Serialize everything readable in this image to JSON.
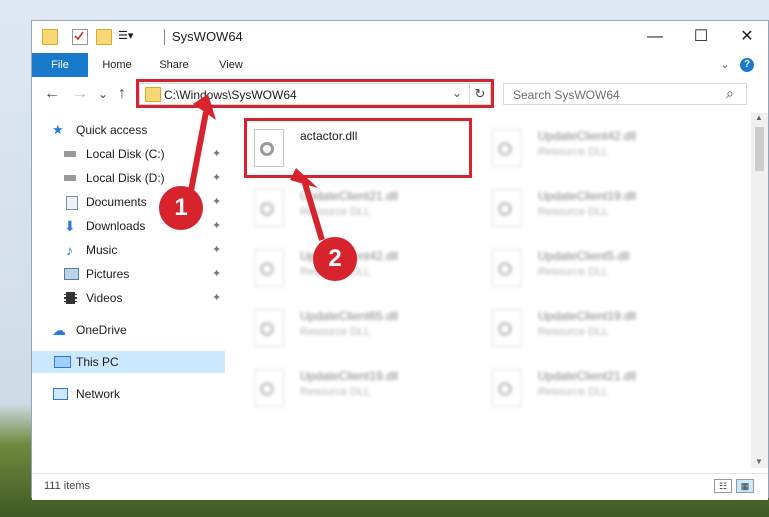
{
  "window": {
    "title": "SysWOW64",
    "minimize": "—",
    "maximize": "☐",
    "close": "✕"
  },
  "ribbon": {
    "tabs": [
      "File",
      "Home",
      "Share",
      "View"
    ],
    "collapse": "⌄",
    "help": "?"
  },
  "nav": {
    "back": "←",
    "forward": "→",
    "recent": "⌄",
    "up": "↑",
    "address": "C:\\Windows\\SysWOW64",
    "dropdown": "⌄",
    "refresh": "↻",
    "search_placeholder": "Search SysWOW64",
    "search_icon": "⌕"
  },
  "sidebar": {
    "items": [
      {
        "label": "Quick access",
        "icon": "star-icon",
        "pinned": false
      },
      {
        "label": "Local Disk (C:)",
        "icon": "drive-icon",
        "pinned": true
      },
      {
        "label": "Local Disk (D:)",
        "icon": "drive-icon",
        "pinned": true
      },
      {
        "label": "Documents",
        "icon": "document-icon",
        "pinned": true
      },
      {
        "label": "Downloads",
        "icon": "download-icon",
        "pinned": true
      },
      {
        "label": "Music",
        "icon": "music-icon",
        "pinned": true
      },
      {
        "label": "Pictures",
        "icon": "pictures-icon",
        "pinned": true
      },
      {
        "label": "Videos",
        "icon": "video-icon",
        "pinned": true
      },
      {
        "label": "OneDrive",
        "icon": "cloud-icon",
        "pinned": false
      },
      {
        "label": "This PC",
        "icon": "computer-icon",
        "pinned": false,
        "selected": true
      },
      {
        "label": "Network",
        "icon": "network-icon",
        "pinned": false
      }
    ],
    "pin_glyph": "📌"
  },
  "files": [
    {
      "name": "actactor.dll",
      "type": "",
      "highlighted": true
    },
    {
      "name": "UpdateClient42.dll",
      "type": "Resource DLL"
    },
    {
      "name": "UpdateClient21.dll",
      "type": "Resource DLL"
    },
    {
      "name": "UpdateClient19.dll",
      "type": "Resource DLL"
    },
    {
      "name": "UpdateClient42.dll",
      "type": "Resource DLL"
    },
    {
      "name": "UpdateClient5.dll",
      "type": "Resource DLL"
    },
    {
      "name": "UpdateClient65.dll",
      "type": "Resource DLL"
    },
    {
      "name": "UpdateClient19.dll",
      "type": "Resource DLL"
    },
    {
      "name": "UpdateClient19.dll",
      "type": "Resource DLL"
    },
    {
      "name": "UpdateClient21.dll",
      "type": "Resource DLL"
    }
  ],
  "status": {
    "items": "111 items"
  },
  "annotations": {
    "marker1": "1",
    "marker2": "2",
    "color": "#d7232c"
  },
  "colors": {
    "accent": "#1979ca",
    "selection": "#cce8ff",
    "folder": "#f8d775"
  }
}
